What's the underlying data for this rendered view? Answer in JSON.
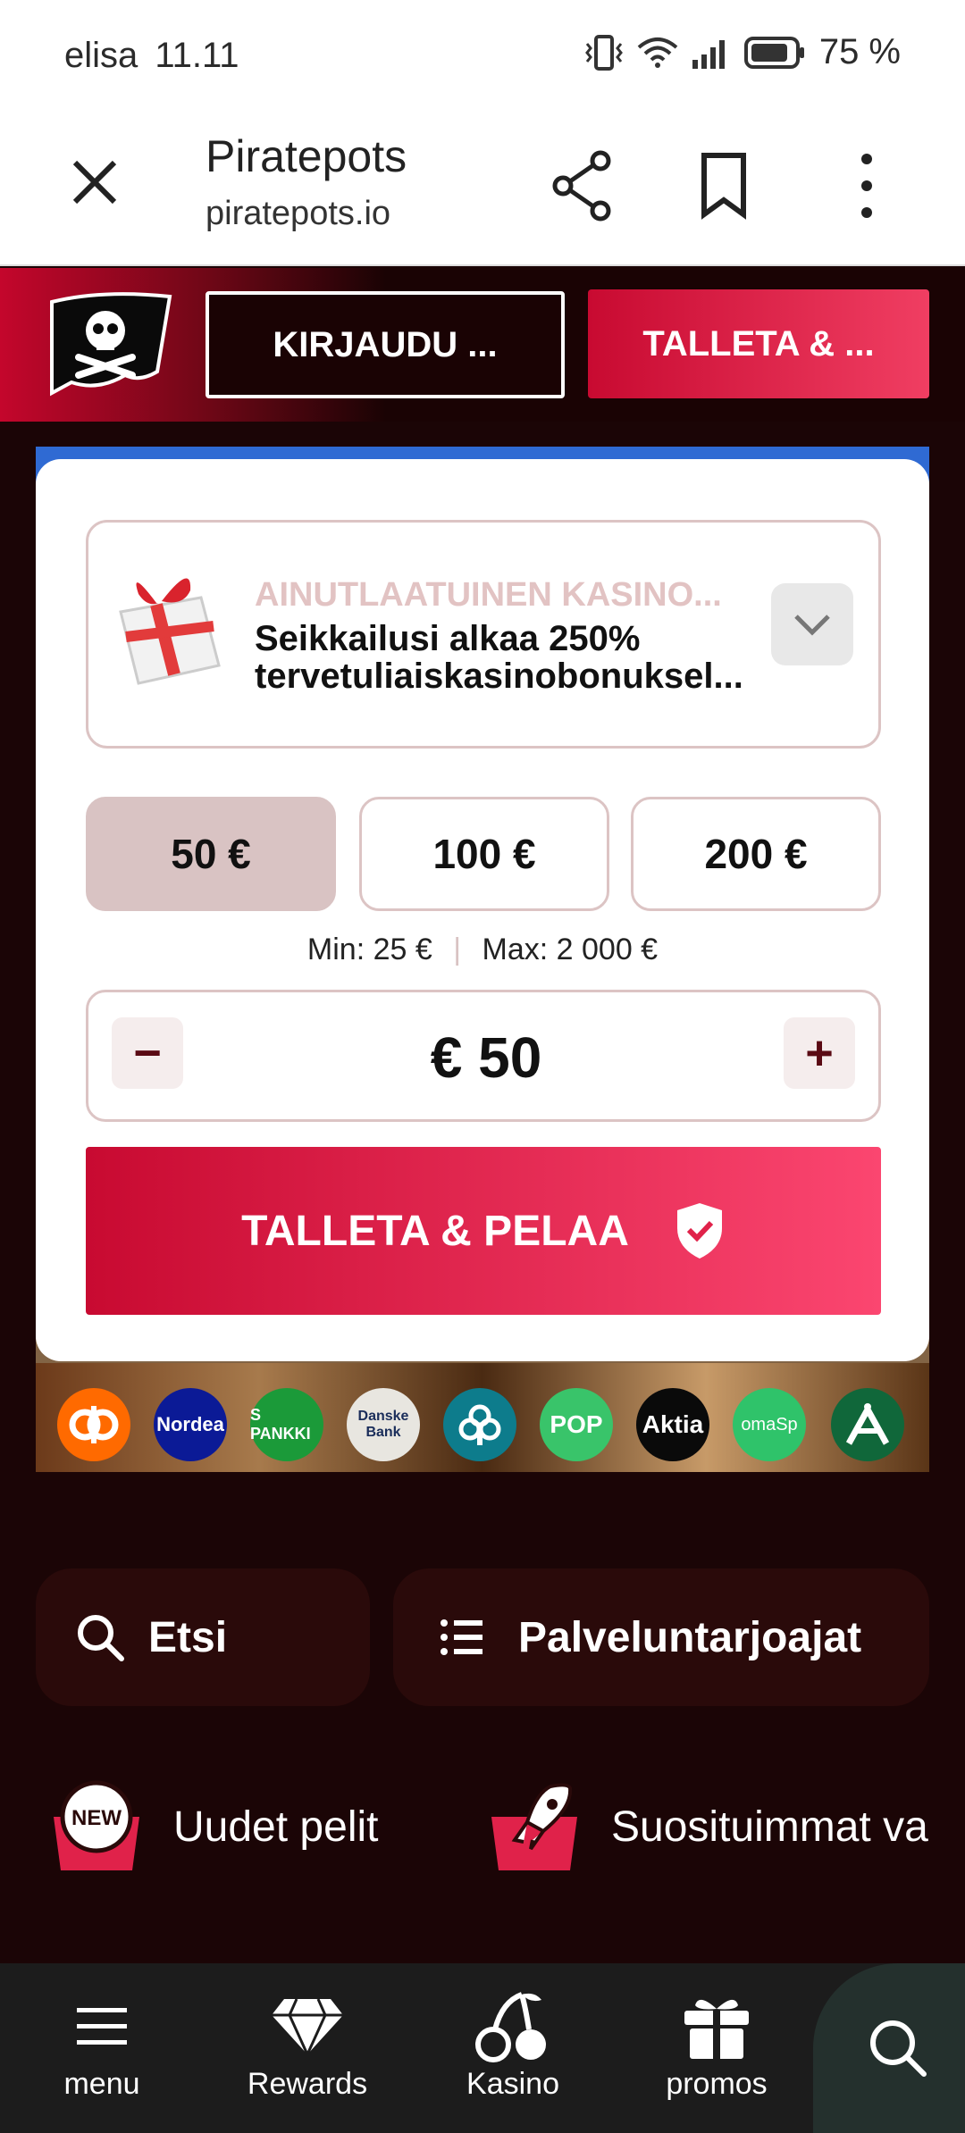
{
  "status_bar": {
    "carrier": "elisa",
    "time": "11.11",
    "battery": "75 %"
  },
  "browser": {
    "title": "Piratepots",
    "url": "piratepots.io"
  },
  "header": {
    "login_label": "KIRJAUDU ...",
    "deposit_label": "TALLETA & ..."
  },
  "bonus": {
    "kicker": "AINUTLAATUINEN KASINO...",
    "line1": "Seikkailusi alkaa 250%",
    "line2": "tervetuliaiskasinobonuksel..."
  },
  "amounts": [
    {
      "label": "50 €",
      "selected": true
    },
    {
      "label": "100 €",
      "selected": false
    },
    {
      "label": "200 €",
      "selected": false
    }
  ],
  "limits": {
    "min": "Min: 25 €",
    "max": "Max: 2 000 €"
  },
  "stepper": {
    "value": "€ 50",
    "minus": "−",
    "plus": "+"
  },
  "cta": {
    "label": "TALLETA & PELAA"
  },
  "banks": [
    {
      "label": "",
      "color": "#ff6a00"
    },
    {
      "label": "Nordea",
      "color": "#0b1a96"
    },
    {
      "label": "S PANKKI",
      "color": "#1b9a39"
    },
    {
      "label": "Danske Bank",
      "color": "#e8e6e0"
    },
    {
      "label": "",
      "color": "#0d7c8c"
    },
    {
      "label": "POP",
      "color": "#39c46a"
    },
    {
      "label": "Aktia",
      "color": "#0a0a0a"
    },
    {
      "label": "omaSp",
      "color": "#2fc36a"
    },
    {
      "label": "",
      "color": "#10673a"
    }
  ],
  "quick": {
    "search": "Etsi",
    "providers": "Palveluntarjoajat"
  },
  "categories": {
    "new_games": "Uudet pelit",
    "popular": "Suosituimmat va"
  },
  "bottom_nav": [
    {
      "label": "menu"
    },
    {
      "label": "Rewards"
    },
    {
      "label": "Kasino"
    },
    {
      "label": "promos"
    }
  ]
}
